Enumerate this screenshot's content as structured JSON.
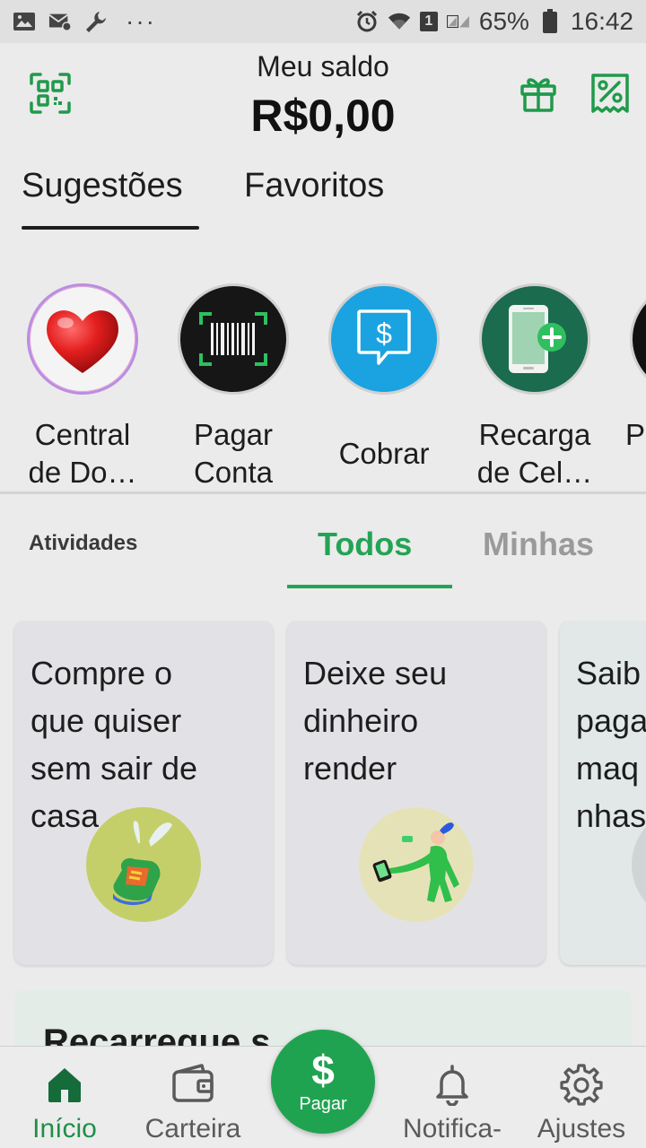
{
  "status_bar": {
    "icons": [
      "image-icon",
      "mail-settings-icon",
      "wrench-icon",
      "more-dots-icon",
      "alarm-icon",
      "wifi-icon",
      "sim-badge",
      "signal-icon",
      "battery-icon"
    ],
    "dots": "···",
    "sim_badge": "1",
    "battery": "65%",
    "time": "16:42"
  },
  "header": {
    "balance_label": "Meu saldo",
    "balance_value": "R$0,00",
    "accent": "#1f9a4a"
  },
  "top_tabs": [
    {
      "label": "Sugestões",
      "active": true
    },
    {
      "label": "Favoritos",
      "active": false
    }
  ],
  "shortcuts": [
    {
      "line1": "Central",
      "line2": "de Do…",
      "icon": "heart-icon"
    },
    {
      "line1": "Pagar",
      "line2": "Conta",
      "icon": "barcode-icon"
    },
    {
      "line1": "Cobrar",
      "icon": "charge-icon"
    },
    {
      "line1": "Recarga",
      "line2": "de Cel…",
      "icon": "phone-recharge-icon"
    },
    {
      "line1": "",
      "line2": "P",
      "icon": "more-shortcut-icon"
    }
  ],
  "activities": {
    "label": "Atividades",
    "tabs": [
      {
        "label": "Todos",
        "active": true
      },
      {
        "label": "Minhas",
        "active": false
      }
    ]
  },
  "cards": [
    {
      "title": "Compre o\nque quiser\nsem sair de\ncasa",
      "image": "sneaker-illustration"
    },
    {
      "title": "Deixe seu\ndinheiro\nrender",
      "image": "person-phone-illustration"
    },
    {
      "title": "Saib\npaga\nmaq\nnhas",
      "image": "partial-illustration"
    }
  ],
  "banner": {
    "title": "Recarregue s"
  },
  "bottom_nav": [
    {
      "label": "Início",
      "icon": "home-icon",
      "active": true
    },
    {
      "label": "Carteira",
      "icon": "wallet-icon",
      "active": false
    },
    {
      "label": "Pagar",
      "icon": "dollar-icon",
      "active": false
    },
    {
      "label": "Notifica-",
      "icon": "bell-icon",
      "active": false
    },
    {
      "label": "Ajustes",
      "icon": "gear-icon",
      "active": false
    }
  ],
  "pay_symbol": "$"
}
